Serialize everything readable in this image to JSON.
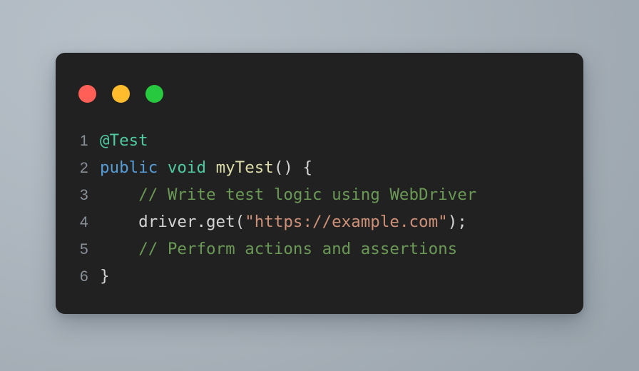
{
  "window": {
    "title": "",
    "background_color": "#212121",
    "traffic_lights": [
      {
        "name": "close",
        "color": "#ff5f56"
      },
      {
        "name": "minimize",
        "color": "#ffbd2e"
      },
      {
        "name": "maximize",
        "color": "#27c93f"
      }
    ]
  },
  "theme": {
    "page_background": "#aeb7bf",
    "editor_background": "#212121",
    "line_number_color": "#8a9199",
    "plain_color": "#d4d4d4",
    "keyword_color": "#569cd6",
    "type_color": "#4ec9a0",
    "annotation_color": "#4ec9a0",
    "function_color": "#dcdcaa",
    "comment_color": "#6a9955",
    "string_color": "#ce9178"
  },
  "editor": {
    "language": "java",
    "line_numbers": [
      "1",
      "2",
      "3",
      "4",
      "5",
      "6"
    ],
    "lines": [
      {
        "number": "1",
        "text": "@Test",
        "tokens": [
          {
            "t": "@Test",
            "c": "annotation"
          }
        ]
      },
      {
        "number": "2",
        "text": "public void myTest() {",
        "tokens": [
          {
            "t": "public",
            "c": "keyword"
          },
          {
            "t": " ",
            "c": "plain"
          },
          {
            "t": "void",
            "c": "type"
          },
          {
            "t": " ",
            "c": "plain"
          },
          {
            "t": "myTest",
            "c": "function"
          },
          {
            "t": "() {",
            "c": "plain"
          }
        ]
      },
      {
        "number": "3",
        "text": "    // Write test logic using WebDriver",
        "tokens": [
          {
            "t": "    ",
            "c": "plain"
          },
          {
            "t": "// Write test logic using WebDriver",
            "c": "comment"
          }
        ]
      },
      {
        "number": "4",
        "text": "    driver.get(\"https://example.com\");",
        "tokens": [
          {
            "t": "    driver.get(",
            "c": "plain"
          },
          {
            "t": "\"https://example.com\"",
            "c": "string"
          },
          {
            "t": ");",
            "c": "plain"
          }
        ]
      },
      {
        "number": "5",
        "text": "    // Perform actions and assertions",
        "tokens": [
          {
            "t": "    ",
            "c": "plain"
          },
          {
            "t": "// Perform actions and assertions",
            "c": "comment"
          }
        ]
      },
      {
        "number": "6",
        "text": "}",
        "tokens": [
          {
            "t": "}",
            "c": "plain"
          }
        ]
      }
    ]
  }
}
